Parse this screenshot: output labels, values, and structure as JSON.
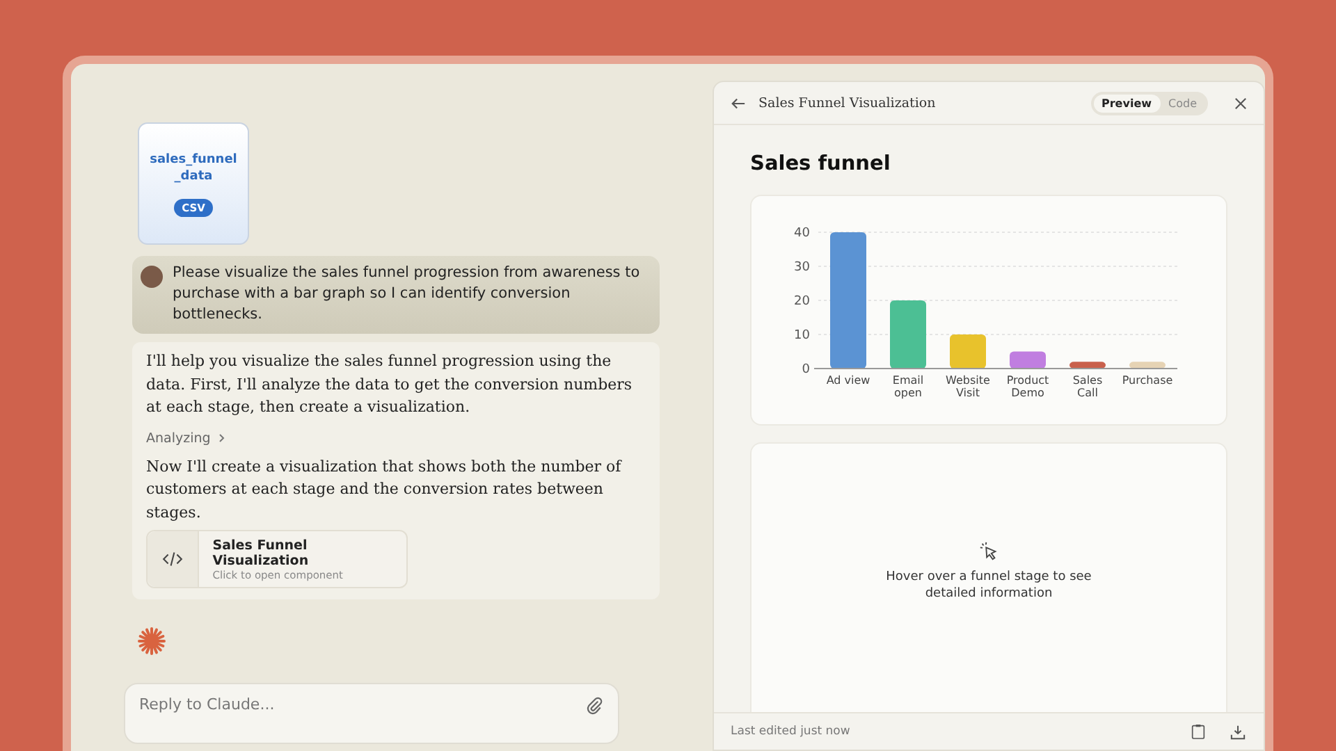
{
  "chat": {
    "attachment": {
      "name": "sales_funnel_data",
      "type": "CSV"
    },
    "user_message": "Please visualize the sales funnel progression from awareness to purchase with a bar graph so I can identify conversion bottlenecks.",
    "reply": {
      "intro": "I'll help you visualize the sales funnel progression using the data. First, I'll analyze the data to get the conversion numbers at each stage, then create a visualization.",
      "step": "Analyzing",
      "followup": "Now I'll create a visualization that shows both the number of customers at each stage and the conversion rates between stages.",
      "artifact": {
        "title": "Sales Funnel Visualization",
        "subtitle": "Click to open component"
      }
    },
    "input": {
      "placeholder": "Reply to Claude..."
    }
  },
  "panel": {
    "title": "Sales Funnel Visualization",
    "tabs": [
      {
        "label": "Preview",
        "selected": true
      },
      {
        "label": "Code",
        "selected": false
      }
    ],
    "heading": "Sales funnel",
    "chart_data": {
      "type": "bar",
      "categories": [
        "Ad view",
        "Email open",
        "Website Visit",
        "Product Demo",
        "Sales Call",
        "Purchase"
      ],
      "grid": true,
      "values": [
        40,
        20,
        10,
        5,
        2,
        2
      ],
      "colors": [
        "#5b93d3",
        "#4cbf94",
        "#e8c22c",
        "#c07ee0",
        "#c9604c",
        "#e6d3b4"
      ],
      "ylim": [
        0,
        40
      ],
      "yticks": [
        0,
        10,
        20,
        30,
        40
      ]
    },
    "hint": "Hover over a funnel stage to see detailed information",
    "footer": "Last edited just now"
  }
}
